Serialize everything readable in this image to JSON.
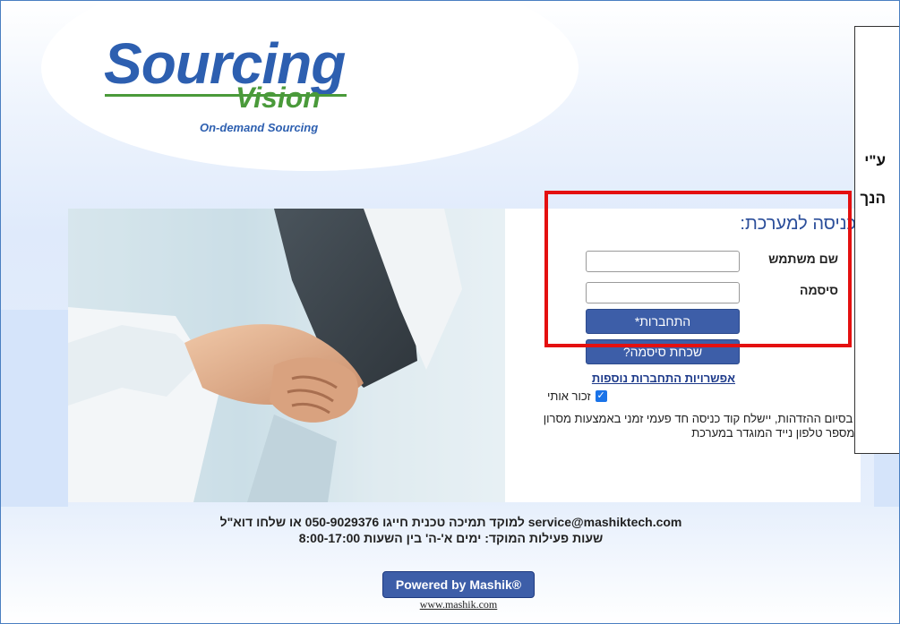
{
  "logo": {
    "word1": "Sourcing",
    "word2": "Vision",
    "tagline": "On-demand Sourcing"
  },
  "login": {
    "title": "כניסה למערכת:",
    "username_label": "שם משתמש",
    "username_value": "",
    "password_label": "סיסמה",
    "password_value": "",
    "login_button": "התחברות*",
    "forgot_button": "שכחת סיסמה?",
    "more_options_link": "אפשרויות התחברות נוספות",
    "remember_label": "זכור אותי",
    "remember_checked": true,
    "note": "* בסיום ההזדהות, יישלח קוד כניסה חד פעמי זמני באמצעות מסרון למספר טלפון נייד המוגדר במערכת"
  },
  "callout": {
    "line1": "ע\"י",
    "line2": "הנך"
  },
  "footer": {
    "support": "למוקד תמיכה טכנית חייגו 050-9029376 או שלחו דוא\"ל service@mashiktech.com",
    "hours": "שעות פעילות המוקד: ימים א'-ה' בין השעות 8:00-17:00",
    "powered_by": "Powered by Mashik®",
    "site_link": "www.mashik.com"
  },
  "colors": {
    "accent": "#3d5ea8",
    "highlight": "#e41010",
    "logo_blue": "#2d5fb0",
    "logo_green": "#4a9a3a"
  }
}
